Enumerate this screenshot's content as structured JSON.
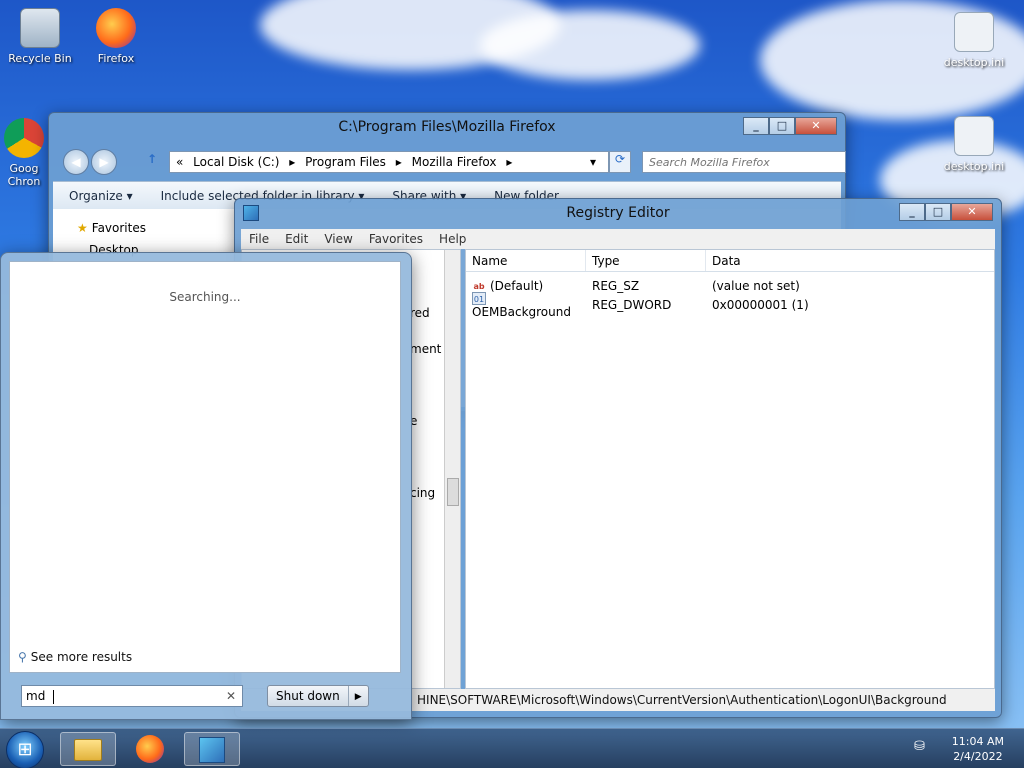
{
  "desktop": {
    "icons": [
      {
        "label": "Recycle Bin",
        "icon": "recycle-bin-icon"
      },
      {
        "label": "Firefox",
        "icon": "firefox-icon"
      },
      {
        "label": "Goog Chron",
        "icon": "chrome-icon"
      },
      {
        "label": "desktop.ini",
        "icon": "ini-file-icon"
      },
      {
        "label": "desktop.ini",
        "icon": "ini-file-icon"
      }
    ]
  },
  "explorer": {
    "title": "C:\\Program Files\\Mozilla Firefox",
    "breadcrumb": [
      "«",
      "Local Disk (C:)",
      "▸",
      "Program Files",
      "▸",
      "Mozilla Firefox",
      "▸"
    ],
    "search_placeholder": "Search Mozilla Firefox",
    "toolbar": [
      "Organize ▾",
      "Include selected folder in library ▾",
      "Share with ▾",
      "New folder"
    ],
    "sidebar": {
      "favorites": "Favorites",
      "desktop": "Desktop"
    }
  },
  "regedit": {
    "title": "Registry Editor",
    "menu": [
      "File",
      "Edit",
      "View",
      "Favorites",
      "Help"
    ],
    "tree_partial": [
      "red",
      "ment",
      "e",
      "cing"
    ],
    "columns": [
      "Name",
      "Type",
      "Data"
    ],
    "rows": [
      {
        "name": "(Default)",
        "type": "REG_SZ",
        "data": "(value not set)",
        "icon": "string-value-icon"
      },
      {
        "name": "OEMBackground",
        "type": "REG_DWORD",
        "data": "0x00000001 (1)",
        "icon": "dword-value-icon"
      }
    ],
    "status_path": "HINE\\SOFTWARE\\Microsoft\\Windows\\CurrentVersion\\Authentication\\LogonUI\\Background"
  },
  "startmenu": {
    "searching": "Searching...",
    "see_more": "See more results",
    "search_value": "md",
    "shutdown": "Shut down"
  },
  "taskbar": {
    "time": "11:04 AM",
    "date": "2/4/2022",
    "items": [
      "explorer-icon",
      "firefox-icon",
      "regedit-icon"
    ]
  }
}
